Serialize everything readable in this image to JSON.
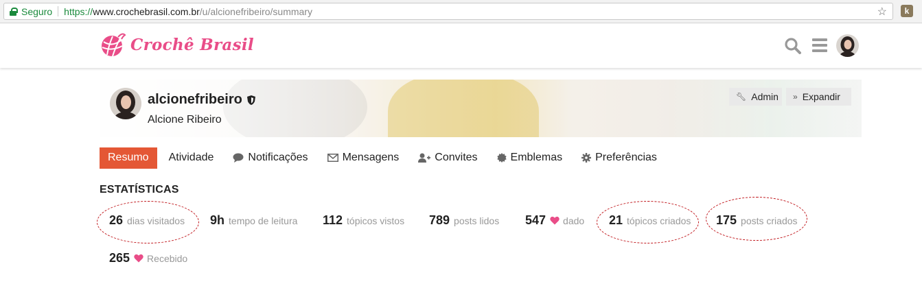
{
  "browser": {
    "secure_label": "Seguro",
    "url_scheme": "https://",
    "url_host": "www.crochebrasil.com.br",
    "url_path": "/u/alcionefribeiro/summary",
    "extension_letter": "k"
  },
  "site": {
    "logo_text": "Crochê Brasil",
    "brand_color": "#e94d88"
  },
  "profile": {
    "username": "alcionefribeiro",
    "full_name": "Alcione Ribeiro",
    "admin_label": "Admin",
    "expand_label": "Expandir"
  },
  "tabs": [
    {
      "label": "Resumo",
      "active": true
    },
    {
      "label": "Atividade"
    },
    {
      "label": "Notificações"
    },
    {
      "label": "Mensagens"
    },
    {
      "label": "Convites"
    },
    {
      "label": "Emblemas"
    },
    {
      "label": "Preferências"
    }
  ],
  "stats": {
    "title": "ESTATÍSTICAS",
    "items": [
      {
        "value": "26",
        "label": "dias visitados"
      },
      {
        "value": "9h",
        "label": "tempo de leitura"
      },
      {
        "value": "112",
        "label": "tópicos vistos"
      },
      {
        "value": "789",
        "label": "posts lidos"
      },
      {
        "value": "547",
        "label": "dado"
      },
      {
        "value": "21",
        "label": "tópicos criados"
      },
      {
        "value": "175",
        "label": "posts criados"
      },
      {
        "value": "265",
        "label": "Recebido"
      }
    ]
  },
  "colors": {
    "active_tab": "#e45735",
    "annotation": "#c0161b",
    "heart": "#e94d88"
  }
}
